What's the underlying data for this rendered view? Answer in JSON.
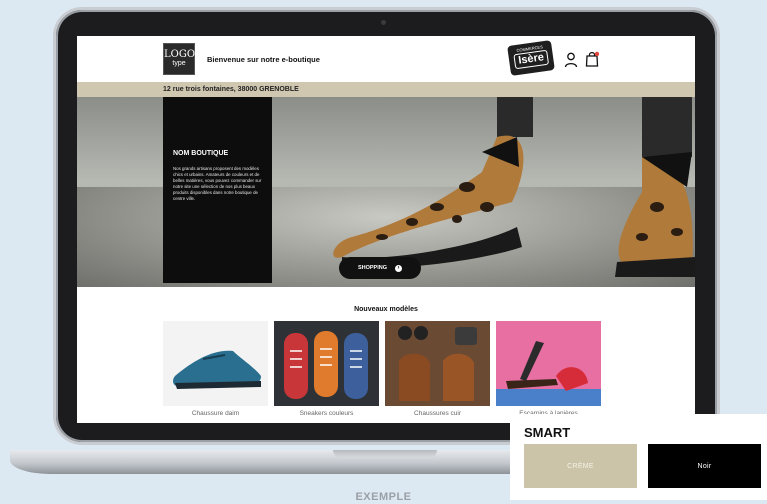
{
  "site": {
    "logo_line1": "LOGO",
    "logo_line2": "type",
    "title": "Bienvenue sur notre e-boutique",
    "badge_small": "COMMERCES",
    "badge_big": "Isère",
    "address": "12 rue trois fontaines, 38000 GRENOBLE"
  },
  "hero": {
    "card_title": "NOM BOUTIQUE",
    "card_text": "Nos grands artisans proposent des modèles chics et urbains. Amateurs de couleurs et de belles matières, vous pouvez commander sur notre site une sélection de nos plus beaux produits disponibles dans notre boutique de centre ville.",
    "button_label": "SHOPPING"
  },
  "new_models": {
    "title": "Nouveaux modèles",
    "products": [
      {
        "label": "Chaussure daim"
      },
      {
        "label": "Sneakers couleurs"
      },
      {
        "label": "Chaussures cuir"
      },
      {
        "label": "Escarpins à lanières"
      }
    ]
  },
  "theme": {
    "title": "SMART",
    "options": [
      {
        "label": "CRÈME",
        "color": "#cbc4a8"
      },
      {
        "label": "Noir",
        "color": "#000000"
      }
    ]
  },
  "footer_label": "EXEMPLE",
  "colors": {
    "accent_beige": "#cfc7b0",
    "dark": "#0d0d0d",
    "background": "#dce8f2"
  }
}
